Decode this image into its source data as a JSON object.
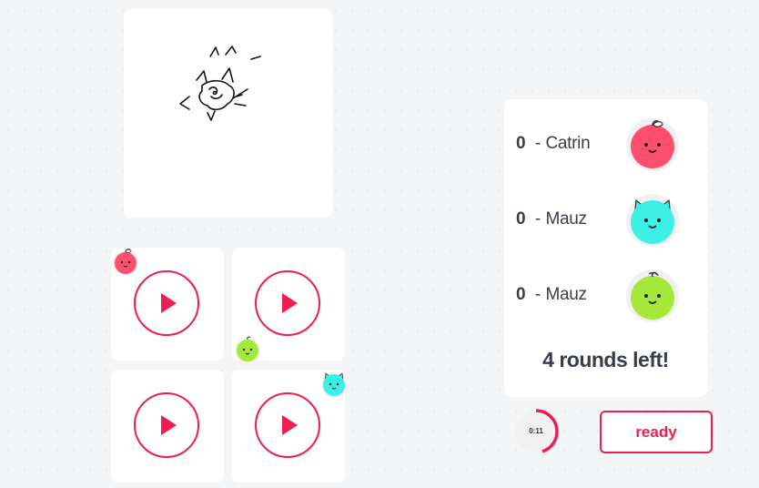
{
  "scoreboard": {
    "players": [
      {
        "score": "0",
        "separator": " - ",
        "name": "Catrin",
        "avatar": "apple-avatar-icon",
        "color": "#ff4f6e"
      },
      {
        "score": "0",
        "separator": " - ",
        "name": "Mauz",
        "avatar": "cat-avatar-icon",
        "color": "#3df0e6"
      },
      {
        "score": "0",
        "separator": " - ",
        "name": "Mauz",
        "avatar": "lime-avatar-icon",
        "color": "#a6e83a"
      }
    ],
    "rounds_left": "4 rounds left!"
  },
  "timer": {
    "text": "0:11",
    "progress": 0.45
  },
  "ready_label": "ready",
  "colors": {
    "accent": "#ee1d52",
    "background": "#f4f5f6"
  }
}
